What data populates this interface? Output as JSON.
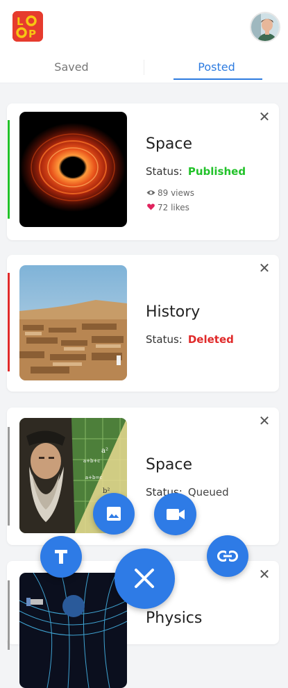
{
  "app": {
    "logo_text": "LOOP",
    "accent_color": "#2d7be0",
    "fab_color": "#2e7be6"
  },
  "tabs": [
    {
      "label": "Saved",
      "active": false
    },
    {
      "label": "Posted",
      "active": true
    }
  ],
  "cards": [
    {
      "title": "Space",
      "status_label": "Status:",
      "status": "Published",
      "status_color": "#22c22a",
      "views": "89 views",
      "likes": "72 likes",
      "thumbnail": "black-hole-image"
    },
    {
      "title": "History",
      "status_label": "Status:",
      "status": "Deleted",
      "status_color": "#e02a2a",
      "thumbnail": "ancient-ruins-image"
    },
    {
      "title": "Space",
      "status_label": "Status:",
      "status": "Queued",
      "status_color": "#444444",
      "thumbnail": "scientist-portrait-image"
    },
    {
      "title": "Physics",
      "thumbnail": "spacetime-grid-image"
    }
  ],
  "fab_menu": {
    "icons": [
      "image-icon",
      "video-icon",
      "text-icon",
      "link-icon",
      "close-icon"
    ]
  }
}
